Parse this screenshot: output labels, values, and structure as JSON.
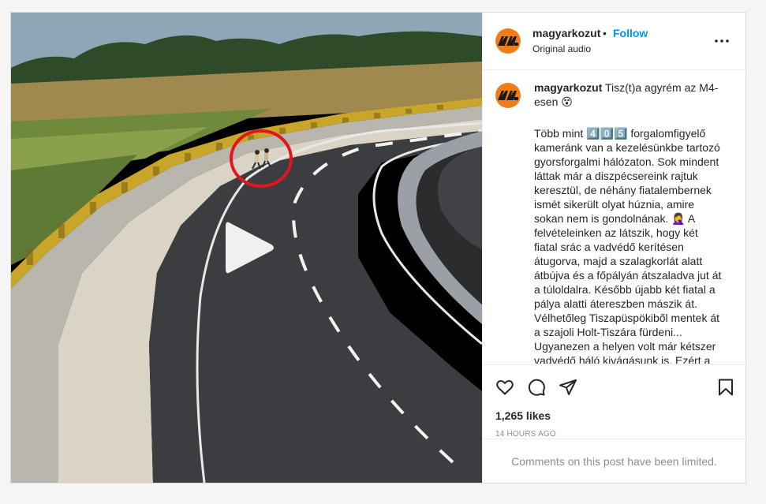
{
  "post": {
    "username": "magyarkozut",
    "separator": "•",
    "follow_label": "Follow",
    "audio_label": "Original audio",
    "more_icon": "more-horizontal-icon",
    "caption": {
      "username": "magyarkozut",
      "title": "Tisz(t)a agyrém az M4-esen 😵",
      "body": "Több mint 4️⃣0️⃣5️⃣ forgalomfigyelő kameránk van a kezelésünkbe tartozó gyorsforgalmi hálózaton. Sok mindent láttak már a diszpécsereink rajtuk keresztül, de néhány fiatalembernek ismét sikerült olyat húznia, amire sokan nem is gondolnának. 🤦‍♀️ A felvételeinken az látszik, hogy két fiatal srác a vadvédő kerítésen átugorva, majd a szalagkorlát alatt átbújva és a főpályán átszaladva jut át a túloldalra. Később újabb két fiatal a pálya alatti áteresz​ben mászik át. Vélhetőleg Tiszapüspökiből mentek át a szajoli Holt-Tiszára fürdeni... Ugyanezen a helyen volt már kétszer vadvédő háló kivágásunk is. Ezért a"
    },
    "likes": "1,265 likes",
    "timestamp": "14 HOURS AGO",
    "comments_notice": "Comments on this post have been limited.",
    "icons": {
      "like": "heart-icon",
      "comment": "comment-icon",
      "share": "send-icon",
      "save": "bookmark-icon",
      "play": "play-icon"
    },
    "colors": {
      "accent": "#0095f6",
      "brand_avatar": "#ef7d1a",
      "highlight_circle": "#e3141b"
    }
  }
}
